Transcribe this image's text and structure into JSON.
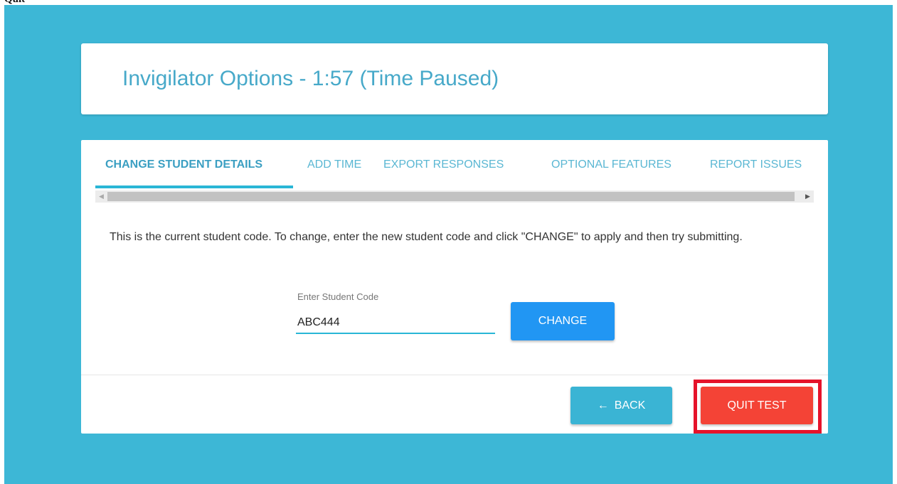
{
  "top_strip": {
    "partial_text": "Quit"
  },
  "dialog": {
    "title": "Invigilator Options - 1:57 (Time Paused)"
  },
  "tabs": [
    {
      "label": "CHANGE STUDENT DETAILS",
      "active": true
    },
    {
      "label": "ADD TIME",
      "active": false
    },
    {
      "label": "EXPORT RESPONSES",
      "active": false
    },
    {
      "label": "OPTIONAL FEATURES",
      "active": false
    },
    {
      "label": "REPORT ISSUES",
      "active": false
    }
  ],
  "scrollbar": {
    "left_icon": "triangle-left-icon",
    "right_icon": "triangle-right-icon"
  },
  "content": {
    "instructions": "This is the current student code. To change, enter the new student code and click \"CHANGE\" to apply and then try submitting.",
    "field_label": "Enter Student Code",
    "field_value": "ABC444",
    "change_label": "CHANGE"
  },
  "footer": {
    "back_label": "BACK",
    "back_icon": "arrow-left-icon",
    "quit_label": "QUIT TEST",
    "quit_highlight_color": "#e5132b"
  },
  "colors": {
    "background": "#3db7d6",
    "accent": "#29b6d6",
    "change_button": "#2196f3",
    "back_button": "#3ab4d4",
    "quit_button": "#f44336"
  }
}
